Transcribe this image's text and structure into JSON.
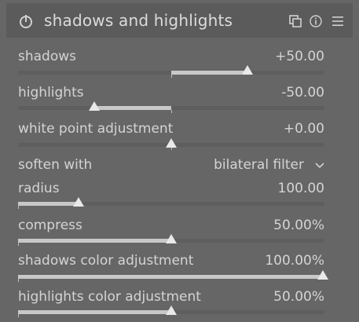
{
  "module": {
    "title": "shadows and highlights",
    "enabled": true
  },
  "header_icons": [
    "power-icon",
    "presets-icon",
    "reset-icon",
    "menu-icon"
  ],
  "sliders": [
    {
      "id": "shadows",
      "label": "shadows",
      "value": "+50.00",
      "min": -100,
      "max": 100,
      "current": 50
    },
    {
      "id": "highlights",
      "label": "highlights",
      "value": "-50.00",
      "min": -100,
      "max": 100,
      "current": -50
    },
    {
      "id": "white-point-adjustment",
      "label": "white point adjustment",
      "value": "+0.00",
      "min": -10,
      "max": 10,
      "current": 0
    }
  ],
  "soften": {
    "label": "soften with",
    "value": "bilateral filter"
  },
  "sliders2": [
    {
      "id": "radius",
      "label": "radius",
      "value": "100.00",
      "fraction": 0.2
    },
    {
      "id": "compress",
      "label": "compress",
      "value": "50.00%",
      "fraction": 0.5
    },
    {
      "id": "shadows-color-adjustment",
      "label": "shadows color adjustment",
      "value": "100.00%",
      "fraction": 1.0
    },
    {
      "id": "highlights-color-adjustment",
      "label": "highlights color adjustment",
      "value": "50.00%",
      "fraction": 0.5
    }
  ],
  "colors": {
    "background": "#666666",
    "header": "#5b5b5b",
    "text": "#d4d4d4",
    "fill": "#c8c8c8",
    "track": "#5e5e5e"
  }
}
